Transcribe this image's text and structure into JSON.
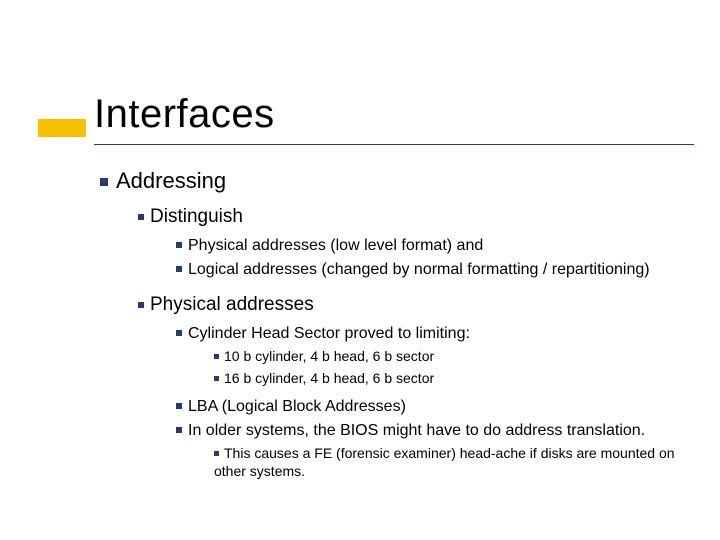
{
  "title": "Interfaces",
  "lvl1": "Addressing",
  "sec1": {
    "heading": "Distinguish",
    "items": [
      "Physical addresses (low level format) and",
      "Logical addresses (changed by normal formatting / repartitioning)"
    ]
  },
  "sec2": {
    "heading": "Physical addresses",
    "chs": {
      "heading": "Cylinder Head Sector proved to limiting:",
      "items": [
        "10 b cylinder, 4 b head, 6 b sector",
        "16 b cylinder, 4 b head, 6 b sector"
      ]
    },
    "lba": "LBA (Logical Block Addresses)",
    "bios": "In older systems, the BIOS might have to do address translation.",
    "bios_sub": "This causes a FE (forensic examiner) head-ache if disks are mounted on other systems."
  }
}
